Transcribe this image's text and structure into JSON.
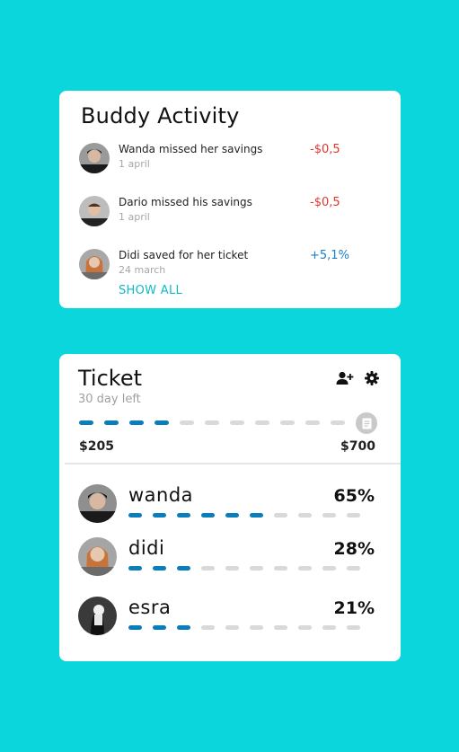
{
  "buddy_activity": {
    "title": "Buddy Activity",
    "items": [
      {
        "text": "Wanda missed her savings",
        "date": "1 april",
        "amount": "-$0,5",
        "type": "negative"
      },
      {
        "text": "Dario missed his savings",
        "date": "1 april",
        "amount": "-$0,5",
        "type": "negative"
      },
      {
        "text": "Didi saved for her ticket",
        "date": "24 march",
        "amount": "+5,1%",
        "type": "positive"
      }
    ],
    "show_all": "SHOW ALL"
  },
  "ticket": {
    "title": "Ticket",
    "subtitle": "30 day left",
    "goal_progress_filled_segments": 4,
    "goal_total_segments": 11,
    "start_amount": "$205",
    "end_amount": "$700",
    "icons": {
      "add_user": "add-user-icon",
      "settings": "gear-icon",
      "goal": "document-icon"
    },
    "members": [
      {
        "name": "wanda",
        "percent": "65%",
        "filled_segments": 6,
        "total_segments": 10
      },
      {
        "name": "didi",
        "percent": "28%",
        "filled_segments": 3,
        "total_segments": 10
      },
      {
        "name": "esra",
        "percent": "21%",
        "filled_segments": 3,
        "total_segments": 10
      }
    ]
  },
  "colors": {
    "background": "#0bd6dc",
    "negative": "#e0342d",
    "positive": "#1a7ec9",
    "progress_on": "#0b7dbd",
    "progress_off": "#d9d9d9",
    "link": "#11b9c7"
  }
}
